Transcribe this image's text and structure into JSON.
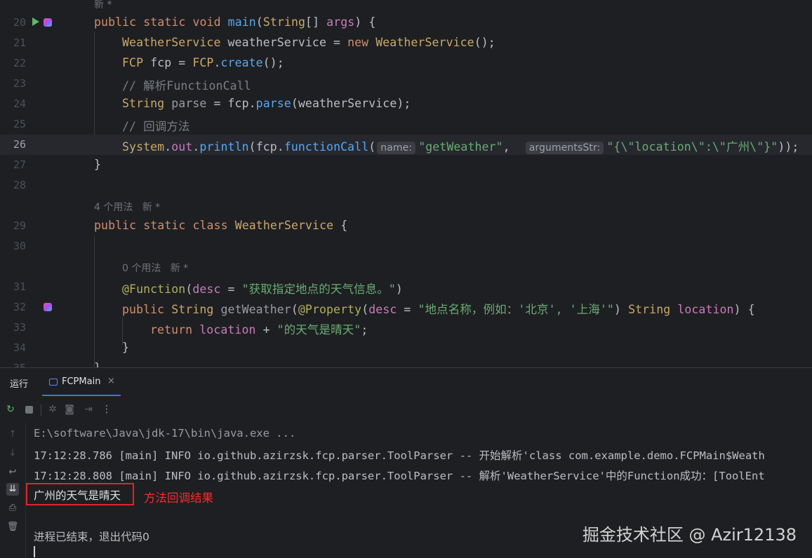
{
  "editor": {
    "current_line": 26,
    "lines": [
      {
        "num": "",
        "hint": "新 *"
      },
      {
        "num": "20",
        "text": "public static void main(String[] args) {"
      },
      {
        "num": "21",
        "text": "WeatherService weatherService = new WeatherService();"
      },
      {
        "num": "22",
        "text": "FCP fcp = FCP.create();"
      },
      {
        "num": "23",
        "text": "// 解析FunctionCall"
      },
      {
        "num": "24",
        "text": "String parse = fcp.parse(weatherService);"
      },
      {
        "num": "25",
        "text": "// 回调方法"
      },
      {
        "num": "26",
        "text": "System.out.println(fcp.functionCall(name: \"getWeather\", argumentsStr: \"{\\\"location\\\":\\\"广州\\\"}\"));"
      },
      {
        "num": "27",
        "text": "}"
      },
      {
        "num": "28",
        "text": ""
      },
      {
        "num": "",
        "hint": "4 个用法   新 *"
      },
      {
        "num": "29",
        "text": "public static class WeatherService {"
      },
      {
        "num": "30",
        "text": ""
      },
      {
        "num": "",
        "hint": "0 个用法   新 *"
      },
      {
        "num": "31",
        "text": "@Function(desc = \"获取指定地点的天气信息。\")"
      },
      {
        "num": "32",
        "text": "public String getWeather(@Property(desc = \"地点名称，例如：'北京', '上海'\") String location) {"
      },
      {
        "num": "33",
        "text": "return location + \"的天气是晴天\";"
      },
      {
        "num": "34",
        "text": "}"
      },
      {
        "num": "35",
        "text": "}"
      }
    ],
    "inlay_hints": {
      "name": "name:",
      "arguments": "argumentsStr:"
    },
    "icons": [
      "run-icon",
      "implementation-icon"
    ]
  },
  "run_panel": {
    "title": "运行",
    "tab": {
      "label": "FCPMain",
      "close": "×",
      "icon": "application-icon"
    },
    "toolbar": [
      "rerun-icon",
      "stop-icon",
      "debug-icon",
      "screenshot-icon",
      "exit-icon",
      "more-icon"
    ],
    "sidebar": [
      "up-arrow-icon",
      "down-arrow-icon",
      "soft-wrap-icon",
      "scroll-to-end-icon",
      "print-icon",
      "trash-icon"
    ],
    "console": {
      "lines": [
        "E:\\software\\Java\\jdk-17\\bin\\java.exe ...",
        "17:12:28.786 [main] INFO io.github.azirzsk.fcp.parser.ToolParser -- 开始解析'class com.example.demo.FCPMain$Weath",
        "17:12:28.808 [main] INFO io.github.azirzsk.fcp.parser.ToolParser -- 解析'WeatherService'中的Function成功：[ToolEnt",
        "广州的天气是晴天",
        "",
        "进程已结束，退出代码0"
      ]
    },
    "annotation": "方法回调结果"
  },
  "watermark": "掘金技术社区 @ Azir12138",
  "colors": {
    "accent": "#3574f0",
    "annotation": "#e0242a",
    "background": "#1e1f22"
  }
}
